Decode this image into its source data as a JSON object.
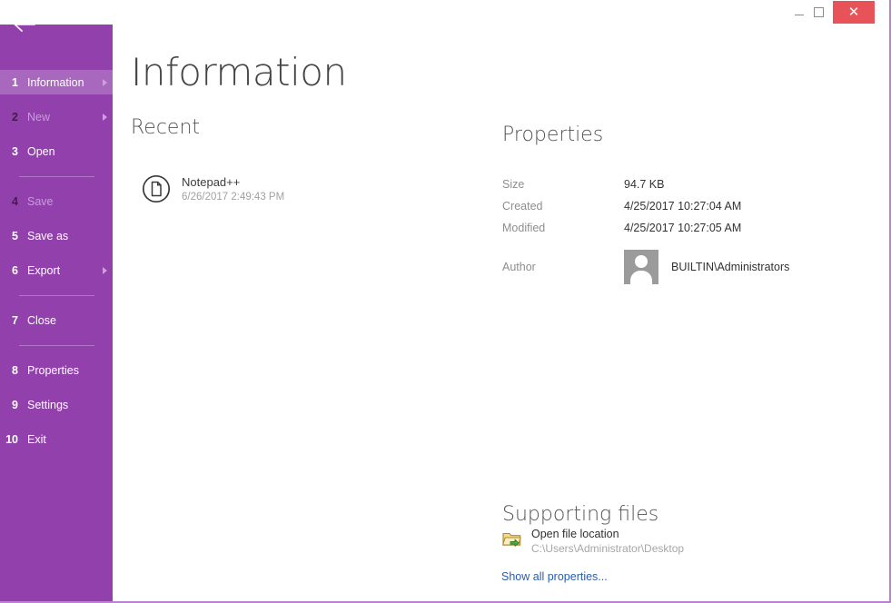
{
  "window": {
    "controls": {
      "minimize_label": "–",
      "maximize_label": "",
      "close_label": "✕"
    },
    "border_color": "#bf7fd4",
    "accent_color": "#9240ac",
    "close_color": "#e8535a"
  },
  "sidebar": {
    "back_label": "",
    "items": [
      {
        "number": "1",
        "label": "Information",
        "state": "active",
        "chevron": true
      },
      {
        "number": "2",
        "label": "New",
        "state": "disabled",
        "chevron": true
      },
      {
        "number": "3",
        "label": "Open",
        "state": "normal",
        "chevron": false
      },
      {
        "number": "4",
        "label": "Save",
        "state": "disabled",
        "chevron": false
      },
      {
        "number": "5",
        "label": "Save as",
        "state": "normal",
        "chevron": false
      },
      {
        "number": "6",
        "label": "Export",
        "state": "normal",
        "chevron": true
      },
      {
        "number": "7",
        "label": "Close",
        "state": "normal",
        "chevron": false
      },
      {
        "number": "8",
        "label": "Properties",
        "state": "normal",
        "chevron": false
      },
      {
        "number": "9",
        "label": "Settings",
        "state": "normal",
        "chevron": false
      },
      {
        "number": "10",
        "label": "Exit",
        "state": "normal",
        "chevron": false
      }
    ]
  },
  "main": {
    "page_title": "Information",
    "recent": {
      "heading": "Recent",
      "items": [
        {
          "name": "Notepad++",
          "date": "6/26/2017 2:49:43 PM"
        }
      ]
    },
    "properties": {
      "heading": "Properties",
      "rows": [
        {
          "label": "Size",
          "value": "94.7 KB"
        },
        {
          "label": "Created",
          "value": "4/25/2017 10:27:04 AM"
        },
        {
          "label": "Modified",
          "value": "4/25/2017 10:27:05 AM"
        }
      ],
      "author": {
        "label": "Author",
        "value": "BUILTIN\\Administrators"
      }
    },
    "supporting_files": {
      "heading": "Supporting files",
      "open_location_title": "Open file location",
      "open_location_path": "C:\\Users\\Administrator\\Desktop",
      "show_all_label": "Show all properties..."
    }
  }
}
